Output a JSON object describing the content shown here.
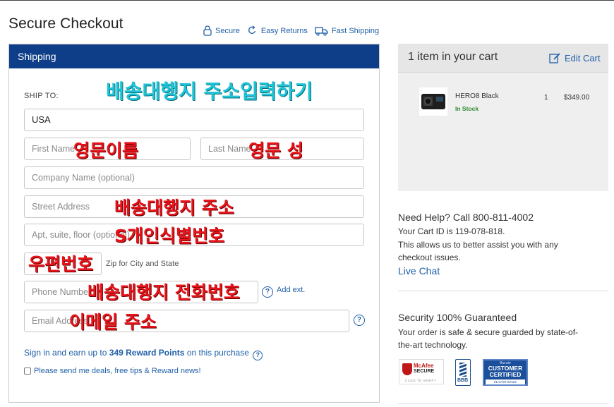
{
  "header": {
    "title": "Secure Checkout",
    "badges": [
      {
        "label": "Secure",
        "icon": "lock-icon"
      },
      {
        "label": "Easy Returns",
        "icon": "return-arrow-icon"
      },
      {
        "label": "Fast Shipping",
        "icon": "truck-icon"
      }
    ]
  },
  "shipping": {
    "header": "Shipping",
    "ship_to_label": "SHIP TO:",
    "country_value": "USA",
    "first_name_placeholder": "First Name",
    "last_name_placeholder": "Last Name",
    "company_placeholder": "Company Name (optional)",
    "street_placeholder": "Street Address",
    "apt_placeholder": "Apt, suite, floor (optional)",
    "zip_hint": "Zip for City and State",
    "phone_placeholder": "Phone Number",
    "add_ext": "Add ext.",
    "email_placeholder": "Email Address",
    "reward_prefix": "Sign in and earn up to ",
    "reward_points": "349 Reward Points",
    "reward_suffix": " on this purchase",
    "newsletter_label": "Please send me deals, free tips & Reward news!"
  },
  "overlays": {
    "title_note": "배송대행지 주소입력하기",
    "first_name_note": "영문이름",
    "last_name_note": "영문 성",
    "street_note": "배송대행지 주소",
    "apt_note": "S개인식별번호",
    "zip_note": "우편번호",
    "phone_note": "배송대행지 전화번호",
    "email_note": "이메일 주소"
  },
  "cart": {
    "count_label": "1 item in your cart",
    "edit_label": "Edit Cart",
    "item": {
      "name": "HERO8 Black",
      "stock": "In Stock",
      "quantity": "1",
      "price": "$349.00",
      "image_icon": "camera-icon"
    }
  },
  "help": {
    "title": "Need Help? Call 800-811-4002",
    "cart_id": "Your Cart ID is 119-078-818.",
    "assist_line1": "This allows us to better assist you with any",
    "assist_line2": "checkout issues.",
    "live_chat": "Live Chat"
  },
  "security": {
    "title": "Security 100% Guaranteed",
    "line1": "Your order is safe & secure guarded by state-of-",
    "line2": "the-art technology.",
    "logos": {
      "mcafee_brand": "McAfee",
      "mcafee_secure": "SECURE",
      "mcafee_verify": "CLICK TO VERIFY",
      "bbb": "BBB",
      "bizrate_top": "Bizrate",
      "bizrate_main1": "CUSTOMER",
      "bizrate_main2": "CERTIFIED",
      "bizrate_bottom": "01/17/20  bizrate"
    }
  },
  "colors": {
    "header_blue": "#0d3e87",
    "link_blue": "#1f5fa8",
    "overlay_red": "#e8141b",
    "overlay_cyan": "#1ec3d6",
    "in_stock_green": "#2e8b2e"
  }
}
